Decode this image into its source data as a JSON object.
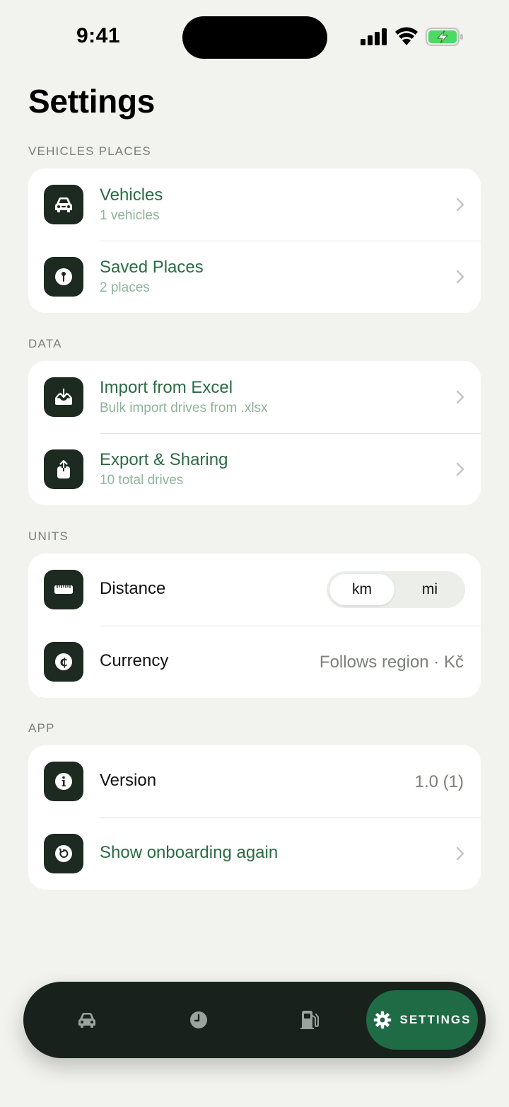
{
  "status_bar": {
    "time": "9:41"
  },
  "page": {
    "title": "Settings"
  },
  "sections": {
    "vehicles_places": {
      "label": "VEHICLES PLACES",
      "vehicles": {
        "title": "Vehicles",
        "subtitle": "1 vehicles",
        "icon": "car-icon"
      },
      "saved_places": {
        "title": "Saved Places",
        "subtitle": "2 places",
        "icon": "pin-icon"
      }
    },
    "data": {
      "label": "DATA",
      "import": {
        "title": "Import from Excel",
        "subtitle": "Bulk import drives from .xlsx",
        "icon": "tray-download-icon"
      },
      "export": {
        "title": "Export & Sharing",
        "subtitle": "10 total drives",
        "icon": "share-icon"
      }
    },
    "units": {
      "label": "UNITS",
      "distance": {
        "title": "Distance",
        "options": [
          "km",
          "mi"
        ],
        "selected": "km",
        "icon": "ruler-icon"
      },
      "currency": {
        "title": "Currency",
        "value": "Follows region · Kč",
        "icon": "cedi-sign-icon"
      }
    },
    "app": {
      "label": "APP",
      "version": {
        "title": "Version",
        "value": "1.0 (1)",
        "icon": "info-icon"
      },
      "onboarding": {
        "title": "Show onboarding again",
        "icon": "reset-icon"
      }
    }
  },
  "tab_bar": {
    "active_label": "SETTINGS",
    "tabs": [
      "car-icon",
      "clock-icon",
      "fuel-pump-icon",
      "gear-icon"
    ]
  },
  "colors": {
    "background": "#f2f3ef",
    "accent_green": "#2a6b43",
    "icon_tile": "#1c2a20",
    "tab_bar": "#18211b",
    "active_tab": "#1f6b45",
    "battery_green": "#4cd964"
  }
}
